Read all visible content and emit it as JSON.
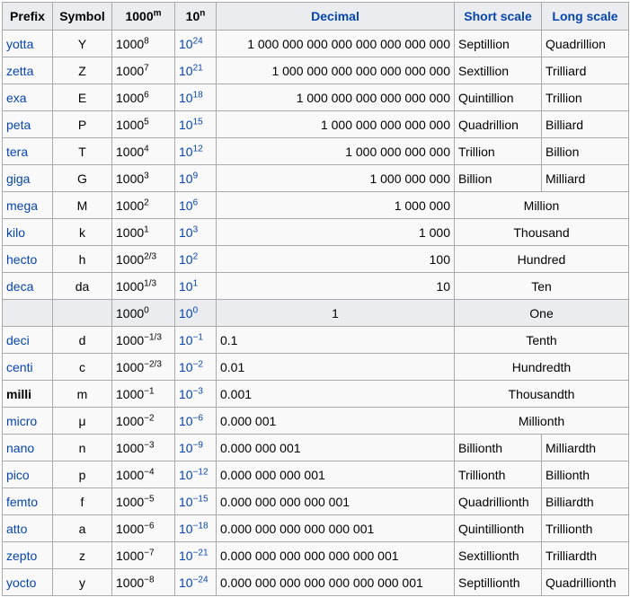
{
  "headers": {
    "prefix": "Prefix",
    "symbol": "Symbol",
    "thousand_base": "1000",
    "thousand_exp": "m",
    "ten_base": "10",
    "ten_exp": "n",
    "decimal": "Decimal",
    "short_scale": "Short scale",
    "long_scale": "Long scale"
  },
  "rows": [
    {
      "prefix": "yotta",
      "symbol": "Y",
      "t_exp": "8",
      "p_exp": "24",
      "decimal": "1 000 000 000 000 000 000 000 000",
      "short": "Septillion",
      "long": "Quadrillion"
    },
    {
      "prefix": "zetta",
      "symbol": "Z",
      "t_exp": "7",
      "p_exp": "21",
      "decimal": "1 000 000 000 000 000 000 000",
      "short": "Sextillion",
      "long": "Trilliard"
    },
    {
      "prefix": "exa",
      "symbol": "E",
      "t_exp": "6",
      "p_exp": "18",
      "decimal": "1 000 000 000 000 000 000",
      "short": "Quintillion",
      "long": "Trillion"
    },
    {
      "prefix": "peta",
      "symbol": "P",
      "t_exp": "5",
      "p_exp": "15",
      "decimal": "1 000 000 000 000 000",
      "short": "Quadrillion",
      "long": "Billiard"
    },
    {
      "prefix": "tera",
      "symbol": "T",
      "t_exp": "4",
      "p_exp": "12",
      "decimal": "1 000 000 000 000",
      "short": "Trillion",
      "long": "Billion"
    },
    {
      "prefix": "giga",
      "symbol": "G",
      "t_exp": "3",
      "p_exp": "9",
      "decimal": "1 000 000 000",
      "short": "Billion",
      "long": "Milliard"
    },
    {
      "prefix": "mega",
      "symbol": "M",
      "t_exp": "2",
      "p_exp": "6",
      "decimal": "1 000 000",
      "scale": "Million"
    },
    {
      "prefix": "kilo",
      "symbol": "k",
      "t_exp": "1",
      "p_exp": "3",
      "decimal": "1 000",
      "scale": "Thousand"
    },
    {
      "prefix": "hecto",
      "symbol": "h",
      "t_exp": "2/3",
      "p_exp": "2",
      "decimal": "100",
      "scale": "Hundred"
    },
    {
      "prefix": "deca",
      "symbol": "da",
      "t_exp": "1/3",
      "p_exp": "1",
      "decimal": "10",
      "scale": "Ten"
    },
    {
      "prefix": "",
      "symbol": "",
      "t_exp": "0",
      "p_exp": "0",
      "decimal": "1",
      "scale": "One"
    },
    {
      "prefix": "deci",
      "symbol": "d",
      "t_exp": "−1/3",
      "p_exp": "−1",
      "decimal": "0.1",
      "scale": "Tenth"
    },
    {
      "prefix": "centi",
      "symbol": "c",
      "t_exp": "−2/3",
      "p_exp": "−2",
      "decimal": "0.01",
      "scale": "Hundredth"
    },
    {
      "prefix": "milli",
      "symbol": "m",
      "t_exp": "−1",
      "p_exp": "−3",
      "decimal": "0.001",
      "scale": "Thousandth"
    },
    {
      "prefix": "micro",
      "symbol": "μ",
      "t_exp": "−2",
      "p_exp": "−6",
      "decimal": "0.000 001",
      "scale": "Millionth"
    },
    {
      "prefix": "nano",
      "symbol": "n",
      "t_exp": "−3",
      "p_exp": "−9",
      "decimal": "0.000 000 001",
      "short": "Billionth",
      "long": "Milliardth"
    },
    {
      "prefix": "pico",
      "symbol": "p",
      "t_exp": "−4",
      "p_exp": "−12",
      "decimal": "0.000 000 000 001",
      "short": "Trillionth",
      "long": "Billionth"
    },
    {
      "prefix": "femto",
      "symbol": "f",
      "t_exp": "−5",
      "p_exp": "−15",
      "decimal": "0.000 000 000 000 001",
      "short": "Quadrillionth",
      "long": "Billiardth"
    },
    {
      "prefix": "atto",
      "symbol": "a",
      "t_exp": "−6",
      "p_exp": "−18",
      "decimal": "0.000 000 000 000 000 001",
      "short": "Quintillionth",
      "long": "Trillionth"
    },
    {
      "prefix": "zepto",
      "symbol": "z",
      "t_exp": "−7",
      "p_exp": "−21",
      "decimal": "0.000 000 000 000 000 000 001",
      "short": "Sextillionth",
      "long": "Trilliardth"
    },
    {
      "prefix": "yocto",
      "symbol": "y",
      "t_exp": "−8",
      "p_exp": "−24",
      "decimal": "0.000 000 000 000 000 000 000 001",
      "short": "Septillionth",
      "long": "Quadrillionth"
    }
  ],
  "colors": {
    "link": "#0645ad",
    "header_bg": "#eaecf0",
    "cell_bg": "#f9f9f9",
    "border": "#aaaaaa"
  }
}
